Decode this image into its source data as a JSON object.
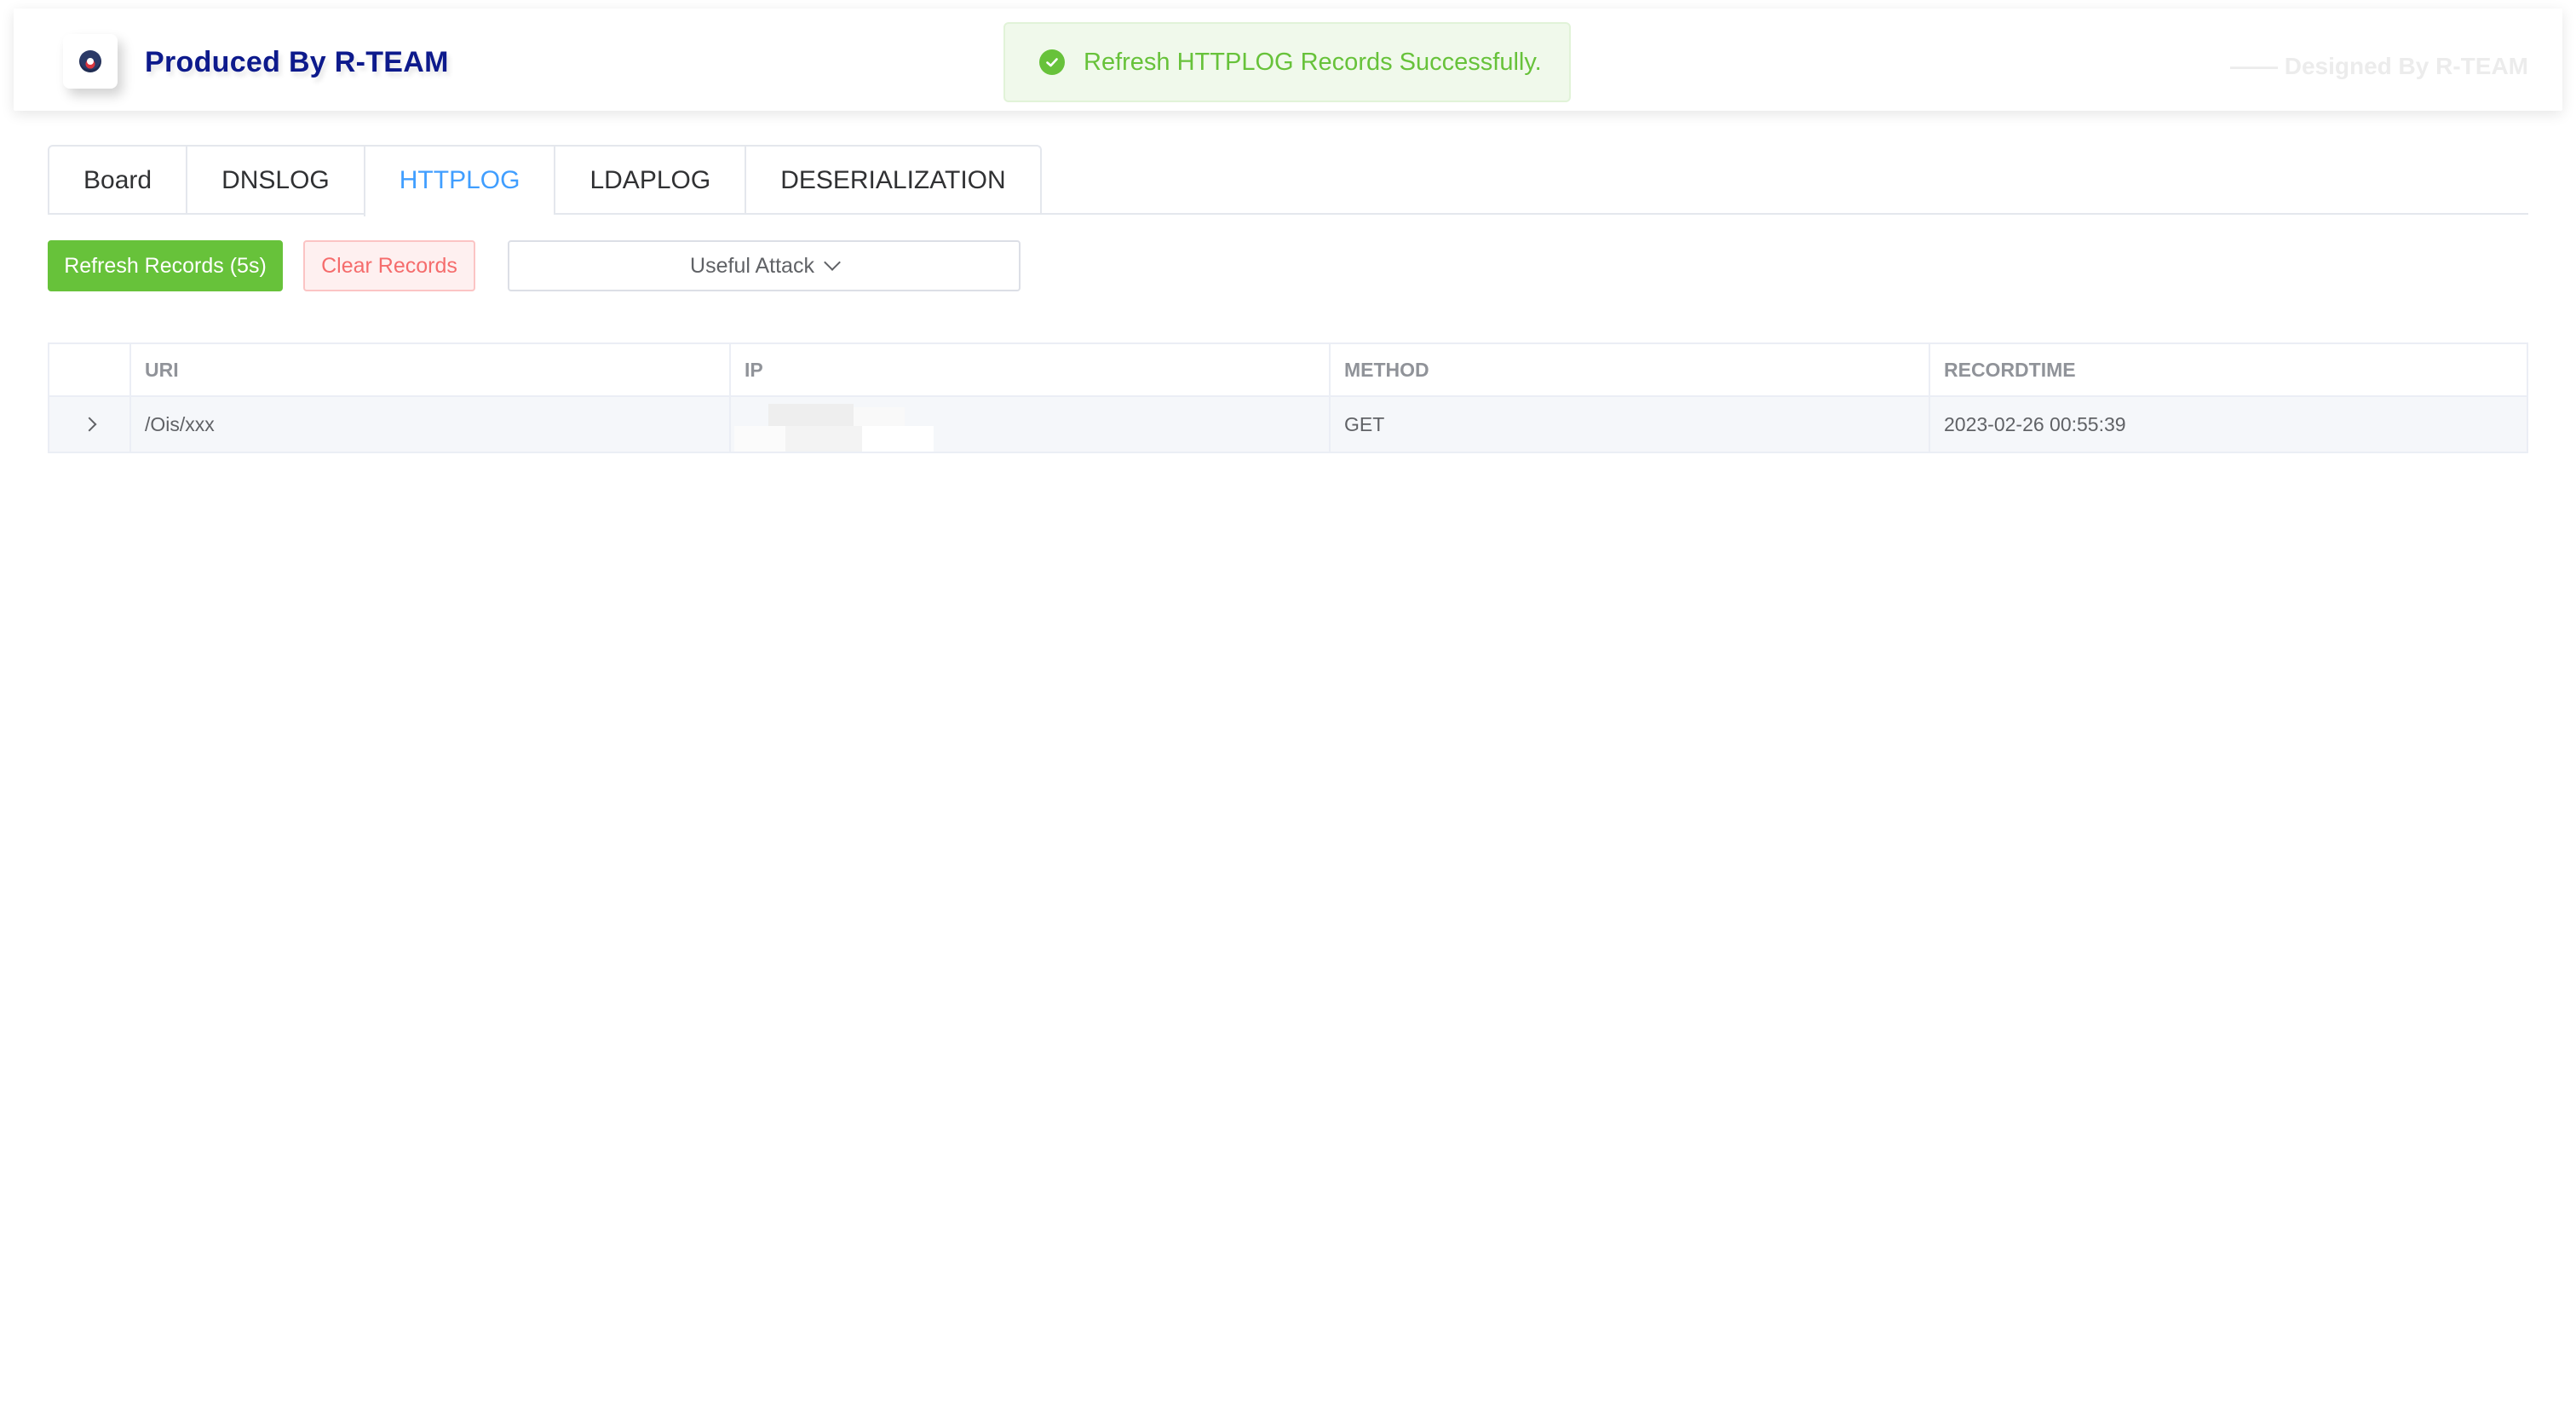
{
  "header": {
    "title": "Produced By R-TEAM",
    "designed_by": "—— Designed By R-TEAM"
  },
  "toast": {
    "message": "Refresh HTTPLOG Records Successfully.",
    "icon": "check-circle-icon",
    "color": "#67c23a"
  },
  "tabs": [
    {
      "label": "Board",
      "active": false
    },
    {
      "label": "DNSLOG",
      "active": false
    },
    {
      "label": "HTTPLOG",
      "active": true
    },
    {
      "label": "LDAPLOG",
      "active": false
    },
    {
      "label": "DESERIALIZATION",
      "active": false
    }
  ],
  "toolbar": {
    "refresh_label": "Refresh Records (5s)",
    "clear_label": "Clear Records",
    "attack_label": "Useful Attack"
  },
  "table": {
    "columns": [
      "URI",
      "IP",
      "METHOD",
      "RECORDTIME"
    ],
    "rows": [
      {
        "uri": "/Ois/xxx",
        "ip": "",
        "method": "GET",
        "recordtime": "2023-02-26 00:55:39"
      }
    ]
  },
  "colors": {
    "accent": "#409eff",
    "success": "#67c23a",
    "danger": "#f56c6c",
    "brand": "#0d1a8c"
  }
}
